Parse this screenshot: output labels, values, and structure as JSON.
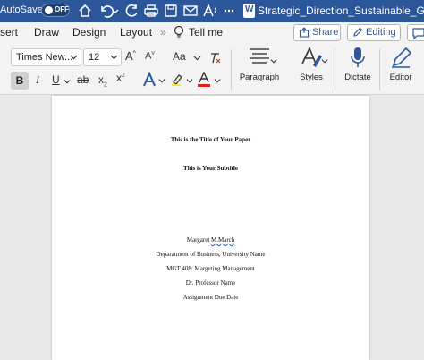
{
  "titlebar": {
    "autosave_label": "AutoSave",
    "autosave_state": "OFF",
    "filename": "Strategic_Direction_Sustainable_Gro..."
  },
  "tabs": {
    "insert": "sert",
    "draw": "Draw",
    "design": "Design",
    "layout": "Layout",
    "more": "»",
    "tell_me": "Tell me",
    "share": "Share",
    "editing": "Editing"
  },
  "ribbon": {
    "font_name": "Times New...",
    "font_size": "12",
    "grow_font": "A",
    "shrink_font": "A",
    "change_case": "Aa",
    "bold": "B",
    "italic": "I",
    "underline": "U",
    "strikethrough": "ab",
    "subscript": "x",
    "superscript": "x",
    "paragraph": "Paragraph",
    "styles": "Styles",
    "dictate": "Dictate",
    "editor": "Editor",
    "accent_color": "#2b579a",
    "font_color": "#e0221f"
  },
  "document": {
    "title": "This is the Title of Your Paper",
    "subtitle": "This is Your Subtitle",
    "author_first": "Margaret",
    "author_last": "M.March",
    "department": "Deparatment of Business, University Name",
    "course": "MGT 408: Margeting Management",
    "professor": "Dr. Professor Name",
    "due_date": "Assignment Due Date"
  }
}
